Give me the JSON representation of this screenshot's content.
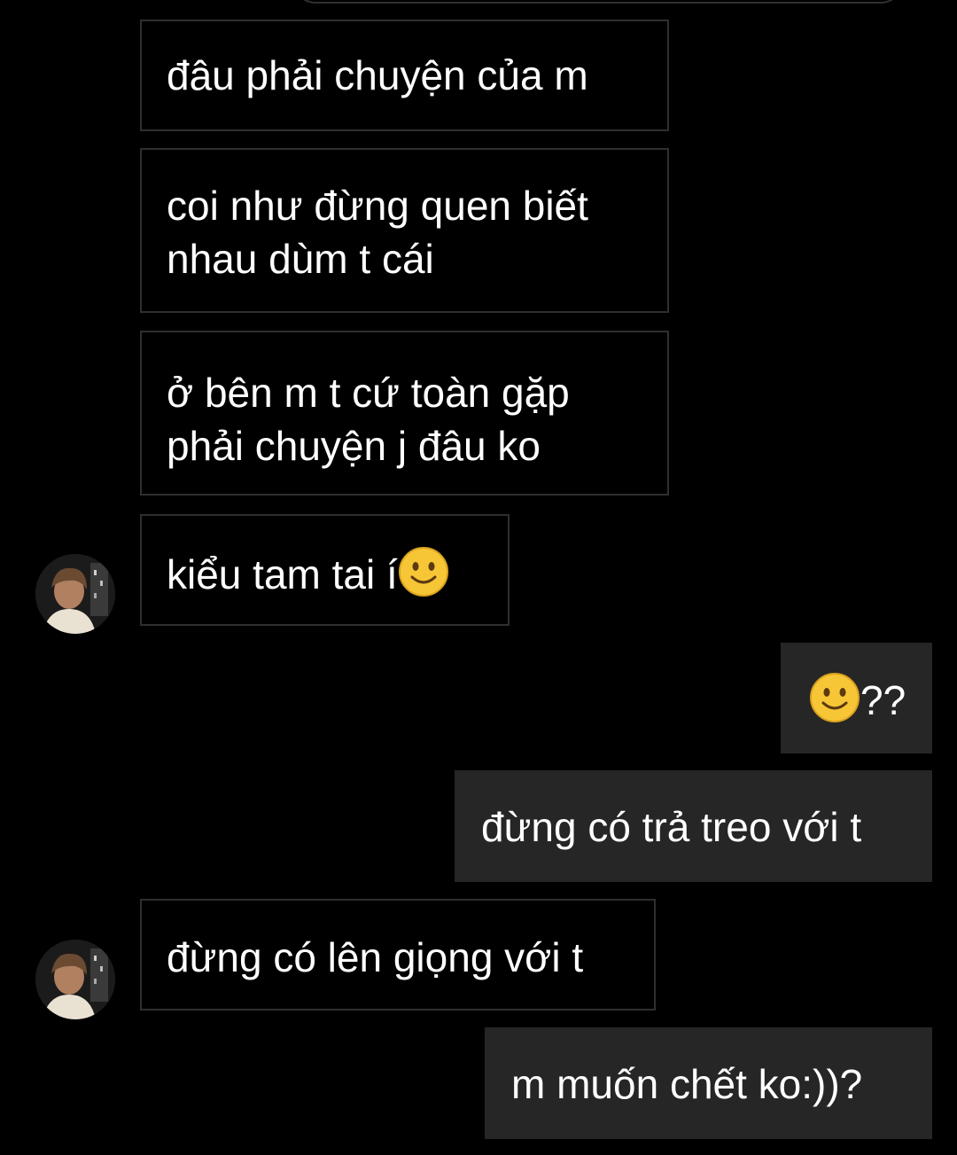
{
  "conversation": {
    "messages": [
      {
        "sender": "other",
        "text": "đâu phải chuyện của m"
      },
      {
        "sender": "other",
        "line1": "coi như đừng quen biết",
        "line2": "nhau dùm t cái"
      },
      {
        "sender": "other",
        "line1": "ở bên m t cứ toàn gặp",
        "line2": "phải chuyện j đâu ko"
      },
      {
        "sender": "other",
        "text": "kiểu tam tai í",
        "emoji": "slightly-smiling-face"
      },
      {
        "sender": "me",
        "text": "??",
        "emoji": "slightly-smiling-face"
      },
      {
        "sender": "me",
        "text": "đừng có trả treo với t"
      },
      {
        "sender": "other",
        "text": "đừng có lên giọng với t"
      },
      {
        "sender": "me",
        "text": "m muốn chết ko:))?"
      }
    ]
  },
  "colors": {
    "background": "#000000",
    "incoming_border": "#2f2f2f",
    "outgoing_bubble": "#262626",
    "text": "#ffffff",
    "emoji_yellow": "#f7c636"
  }
}
